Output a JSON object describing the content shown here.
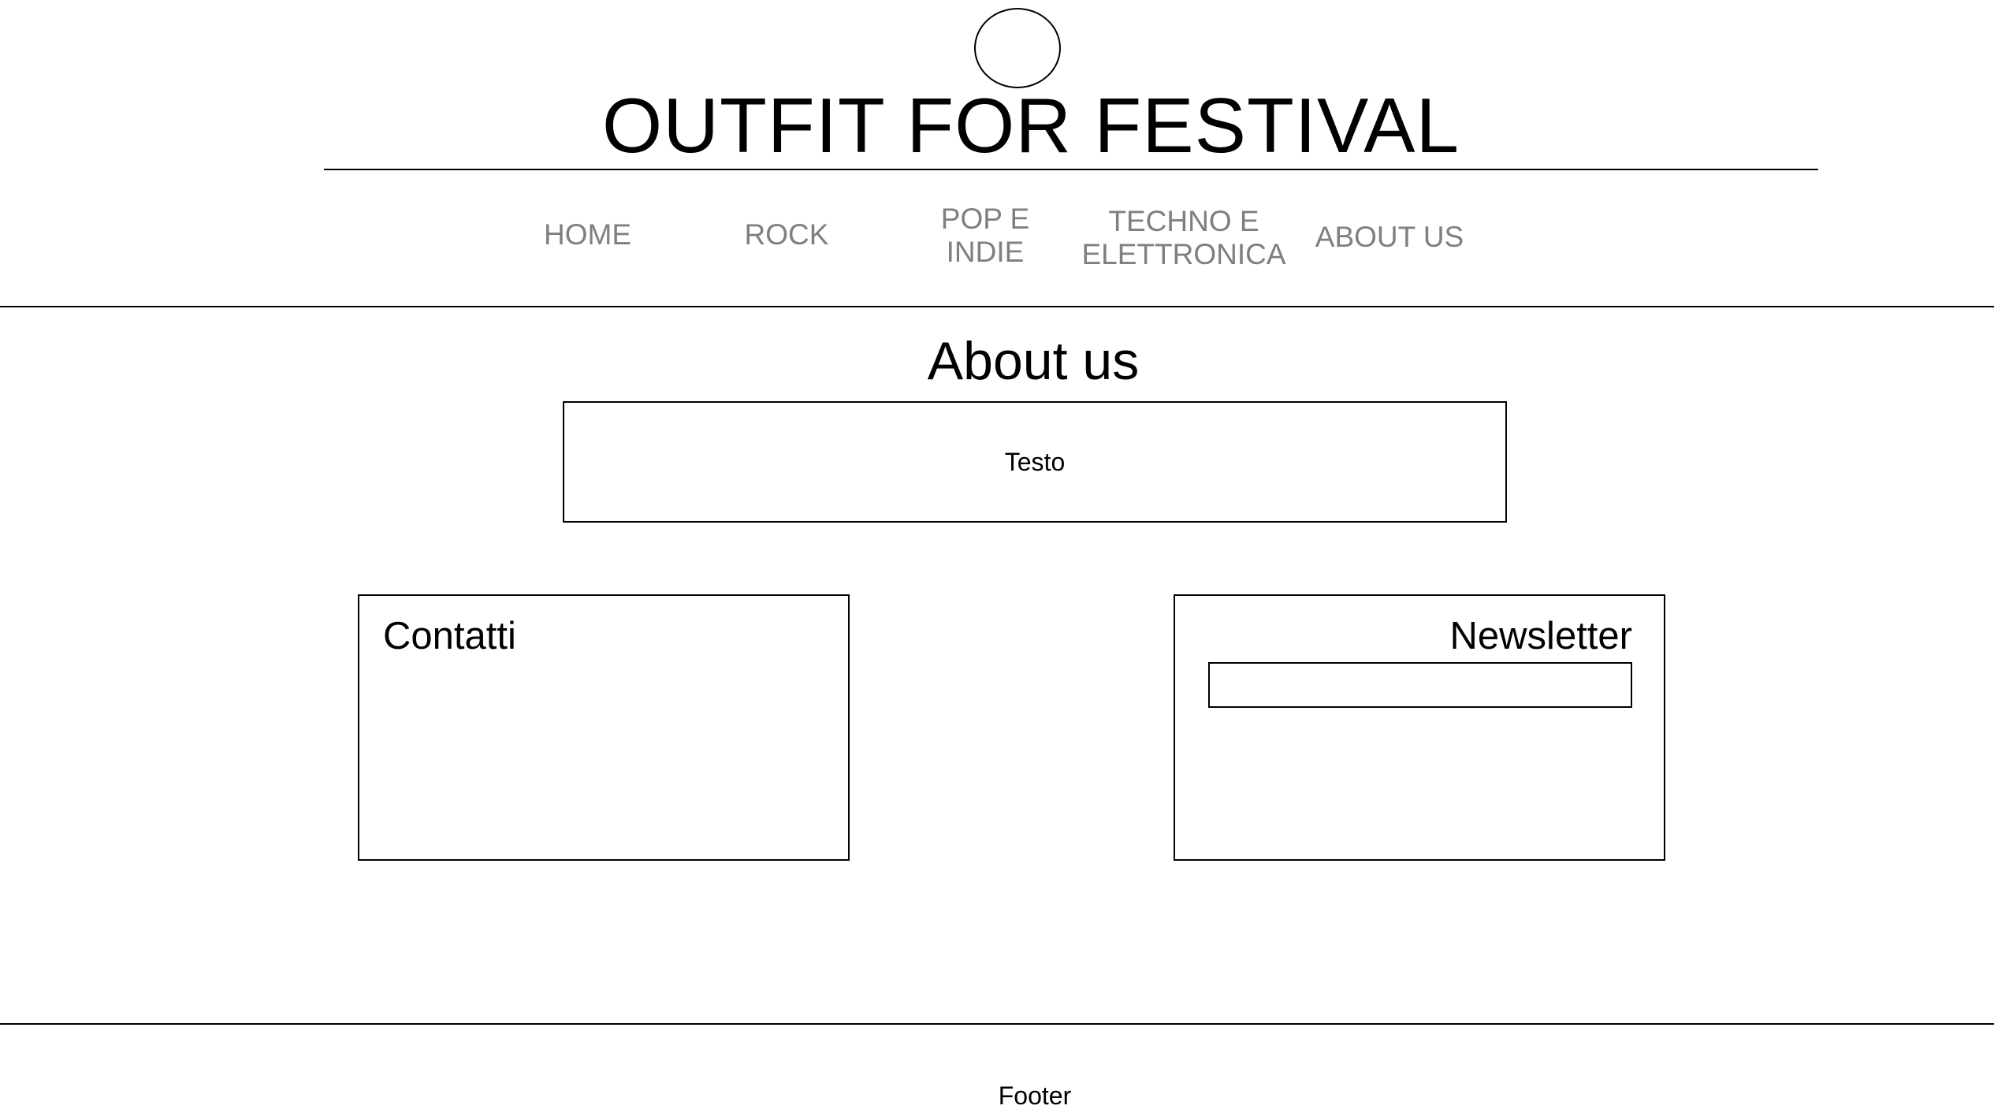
{
  "header": {
    "title": "OUTFIT FOR FESTIVAL"
  },
  "nav": {
    "items": [
      {
        "line1": "HOME",
        "line2": ""
      },
      {
        "line1": "ROCK",
        "line2": ""
      },
      {
        "line1": "POP E",
        "line2": "INDIE"
      },
      {
        "line1": "TECHNO E",
        "line2": "ELETTRONICA"
      },
      {
        "line1": "ABOUT US",
        "line2": ""
      }
    ],
    "color": "#7f7f7f"
  },
  "main": {
    "heading": "About us",
    "text_box": "Testo",
    "contacts": {
      "title": "Contatti"
    },
    "newsletter": {
      "title": "Newsletter",
      "input_value": ""
    }
  },
  "footer": {
    "text": "Footer"
  }
}
